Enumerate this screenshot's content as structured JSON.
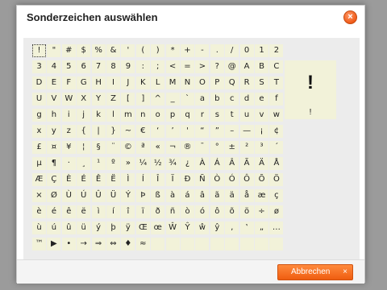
{
  "dialog": {
    "title": "Sonderzeichen auswählen",
    "close_icon_glyph": "×",
    "cancel_label": "Abbrechen",
    "cancel_icon_glyph": "×"
  },
  "preview": {
    "large": "!",
    "small": "!"
  },
  "selected_index": 0,
  "characters": [
    "!",
    "\"",
    "#",
    "$",
    "%",
    "&",
    "'",
    "(",
    ")",
    "*",
    "+",
    "-",
    ".",
    "/",
    "0",
    "1",
    "2",
    "3",
    "4",
    "5",
    "6",
    "7",
    "8",
    "9",
    ":",
    ";",
    "<",
    "=",
    ">",
    "?",
    "@",
    "A",
    "B",
    "C",
    "D",
    "E",
    "F",
    "G",
    "H",
    "I",
    "J",
    "K",
    "L",
    "M",
    "N",
    "O",
    "P",
    "Q",
    "R",
    "S",
    "T",
    "U",
    "V",
    "W",
    "X",
    "Y",
    "Z",
    "[",
    "]",
    "^",
    "_",
    "`",
    "a",
    "b",
    "c",
    "d",
    "e",
    "f",
    "g",
    "h",
    "i",
    "j",
    "k",
    "l",
    "m",
    "n",
    "o",
    "p",
    "q",
    "r",
    "s",
    "t",
    "u",
    "v",
    "w",
    "x",
    "y",
    "z",
    "{",
    "|",
    "}",
    "~",
    "€",
    "‘",
    "’",
    "'",
    "“",
    "”",
    "–",
    "—",
    "¡",
    "¢",
    "£",
    "¤",
    "¥",
    "¦",
    "§",
    "¨",
    "©",
    "ª",
    "«",
    "¬",
    "®",
    "¯",
    "°",
    "±",
    "²",
    "³",
    "´",
    "µ",
    "¶",
    "·",
    "¸",
    "¹",
    "º",
    "»",
    "¼",
    "½",
    "¾",
    "¿",
    "À",
    "Á",
    "Â",
    "Ã",
    "Ä",
    "Å",
    "Æ",
    "Ç",
    "È",
    "É",
    "Ê",
    "Ë",
    "Ì",
    "Í",
    "Î",
    "Ï",
    "Ð",
    "Ñ",
    "Ò",
    "Ó",
    "Ô",
    "Õ",
    "Ö",
    "×",
    "Ø",
    "Ù",
    "Ú",
    "Û",
    "Ü",
    "Ý",
    "Þ",
    "ß",
    "à",
    "á",
    "â",
    "ã",
    "ä",
    "å",
    "æ",
    "ç",
    "è",
    "é",
    "ê",
    "ë",
    "ì",
    "í",
    "î",
    "ï",
    "ð",
    "ñ",
    "ò",
    "ó",
    "ô",
    "õ",
    "ö",
    "÷",
    "ø",
    "ù",
    "ú",
    "û",
    "ü",
    "ý",
    "þ",
    "ÿ",
    "Œ",
    "œ",
    "Ŵ",
    "Ŷ",
    "ŵ",
    "ŷ",
    "‚",
    "‛",
    "„",
    "…",
    "™",
    "▶",
    "•",
    "→",
    "⇒",
    "⇔",
    "♦",
    "≈",
    "",
    "",
    "",
    "",
    "",
    "",
    "",
    "",
    ""
  ],
  "colors": {
    "accent": "#f05a18",
    "cell_bg": "#f2f2d9",
    "panel_bg": "#ececec"
  }
}
